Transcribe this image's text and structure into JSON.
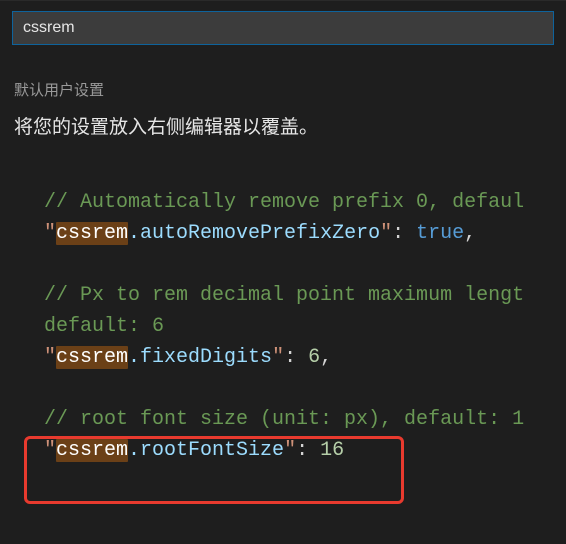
{
  "search": {
    "value": "cssrem",
    "placeholder": ""
  },
  "sectionTitle": "默认用户设置",
  "description": "将您的设置放入右侧编辑器以覆盖。",
  "matchToken": "cssrem",
  "settings": [
    {
      "comment": "// Automatically remove prefix 0, defaul",
      "key": "cssrem.autoRemovePrefixZero",
      "valueType": "boolean",
      "value": "true",
      "trailingComma": true
    },
    {
      "comment": "// Px to rem decimal point maximum lengt",
      "comment2": "default: 6",
      "key": "cssrem.fixedDigits",
      "valueType": "number",
      "value": "6",
      "trailingComma": true
    },
    {
      "comment": "// root font size (unit: px), default: 1",
      "key": "cssrem.rootFontSize",
      "valueType": "number",
      "value": "16",
      "trailingComma": false
    }
  ]
}
